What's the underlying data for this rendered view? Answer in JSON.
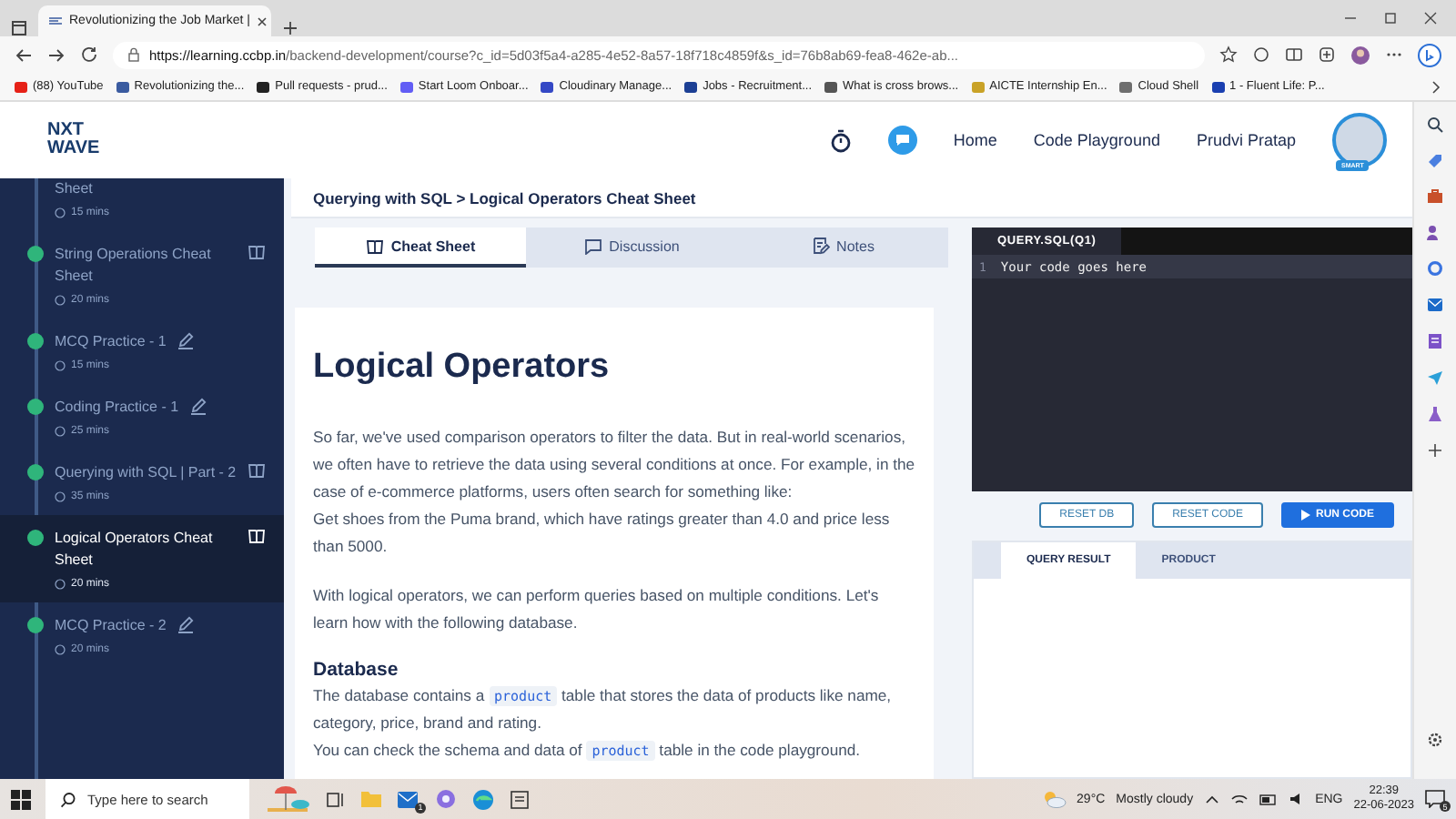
{
  "browser": {
    "tab_title": "Revolutionizing the Job Market |",
    "url_host": "https://learning.ccbp.in",
    "url_path": "/backend-development/course?c_id=5d03f5a4-a285-4e52-8a57-18f718c4859f&s_id=76b8ab69-fea8-462e-ab...",
    "bookmarks": [
      {
        "label": "(88) YouTube",
        "color": "#e62117"
      },
      {
        "label": "Revolutionizing the...",
        "color": "#3a5ba0"
      },
      {
        "label": "Pull requests - prud...",
        "color": "#222222"
      },
      {
        "label": "Start Loom Onboar...",
        "color": "#625df5"
      },
      {
        "label": "Cloudinary Manage...",
        "color": "#3448c5"
      },
      {
        "label": "Jobs - Recruitment...",
        "color": "#1c3f94"
      },
      {
        "label": "What is cross brows...",
        "color": "#555555"
      },
      {
        "label": "AICTE Internship En...",
        "color": "#c9a227"
      },
      {
        "label": "Cloud Shell",
        "color": "#6e6e6e"
      },
      {
        "label": "1 - Fluent Life: P...",
        "color": "#1a3fb0"
      }
    ]
  },
  "header": {
    "logo": [
      "NXT",
      "WAVE"
    ],
    "nav": [
      "Home",
      "Code Playground"
    ],
    "user_name": "Prudvi Pratap",
    "avatar_badge": "SMART"
  },
  "sidebar": {
    "items": [
      {
        "title": "Sheet",
        "duration": "15 mins",
        "kind": "none",
        "completed": false,
        "selected": false
      },
      {
        "title": "String Operations Cheat Sheet",
        "duration": "20 mins",
        "kind": "book",
        "completed": true,
        "selected": false
      },
      {
        "title": "MCQ Practice - 1",
        "duration": "15 mins",
        "kind": "pencil",
        "completed": true,
        "selected": false
      },
      {
        "title": "Coding Practice - 1",
        "duration": "25 mins",
        "kind": "pencil",
        "completed": true,
        "selected": false
      },
      {
        "title": "Querying with SQL | Part - 2",
        "duration": "35 mins",
        "kind": "book",
        "completed": true,
        "selected": false
      },
      {
        "title": "Logical Operators Cheat Sheet",
        "duration": "20 mins",
        "kind": "book",
        "completed": true,
        "selected": true
      },
      {
        "title": "MCQ Practice - 2",
        "duration": "20 mins",
        "kind": "pencil",
        "completed": true,
        "selected": false
      }
    ]
  },
  "breadcrumb": "Querying with SQL > Logical Operators Cheat Sheet",
  "tabs": [
    {
      "label": "Cheat Sheet",
      "kind": "book",
      "selected": true
    },
    {
      "label": "Discussion",
      "kind": "chat",
      "selected": false
    },
    {
      "label": "Notes",
      "kind": "note",
      "selected": false
    }
  ],
  "article": {
    "title": "Logical Operators",
    "blocks": [
      {
        "kind": "paragraph",
        "parts": [
          {
            "kind": "text",
            "text": "So far, we've used comparison operators to filter the data. But in real-world scenarios, we often have to retrieve the data using several conditions at once. For example, in the case of e-commerce platforms, users often search for something like:"
          },
          {
            "kind": "break"
          },
          {
            "kind": "text",
            "text": "Get shoes from the Puma brand, which have ratings greater than 4.0 and price less than 5000."
          }
        ]
      },
      {
        "kind": "paragraph",
        "parts": [
          {
            "kind": "text",
            "text": "With logical operators, we can perform queries based on multiple conditions. Let's learn how with the following database."
          }
        ]
      },
      {
        "kind": "heading",
        "parts": [
          {
            "kind": "text",
            "text": "Database"
          }
        ]
      },
      {
        "kind": "paragraph",
        "parts": [
          {
            "kind": "text",
            "text": "The database contains a "
          },
          {
            "kind": "code",
            "text": "product"
          },
          {
            "kind": "text",
            "text": " table that stores the data of products like name, category, price, brand and rating."
          },
          {
            "kind": "break"
          },
          {
            "kind": "text",
            "text": "You can check the schema and data of "
          },
          {
            "kind": "code",
            "text": "product"
          },
          {
            "kind": "text",
            "text": " table in the code playground."
          }
        ]
      }
    ]
  },
  "editor": {
    "file_tab": "QUERY.SQL(Q1)",
    "lines": [
      {
        "number": "1",
        "code": "Your code goes here"
      }
    ],
    "buttons": [
      {
        "label": "RESET DB",
        "kind": "outline"
      },
      {
        "label": "RESET CODE",
        "kind": "outline"
      },
      {
        "label": "RUN CODE",
        "kind": "primary"
      }
    ],
    "result_tabs": [
      {
        "label": "QUERY RESULT",
        "selected": true
      },
      {
        "label": "PRODUCT",
        "selected": false
      }
    ]
  },
  "taskbar": {
    "search_placeholder": "Type here to search",
    "mail_badge": "1",
    "temperature": "29°C",
    "condition": "Mostly cloudy",
    "language": "ENG",
    "time": "22:39",
    "date": "22-06-2023",
    "notification_count": "5"
  }
}
